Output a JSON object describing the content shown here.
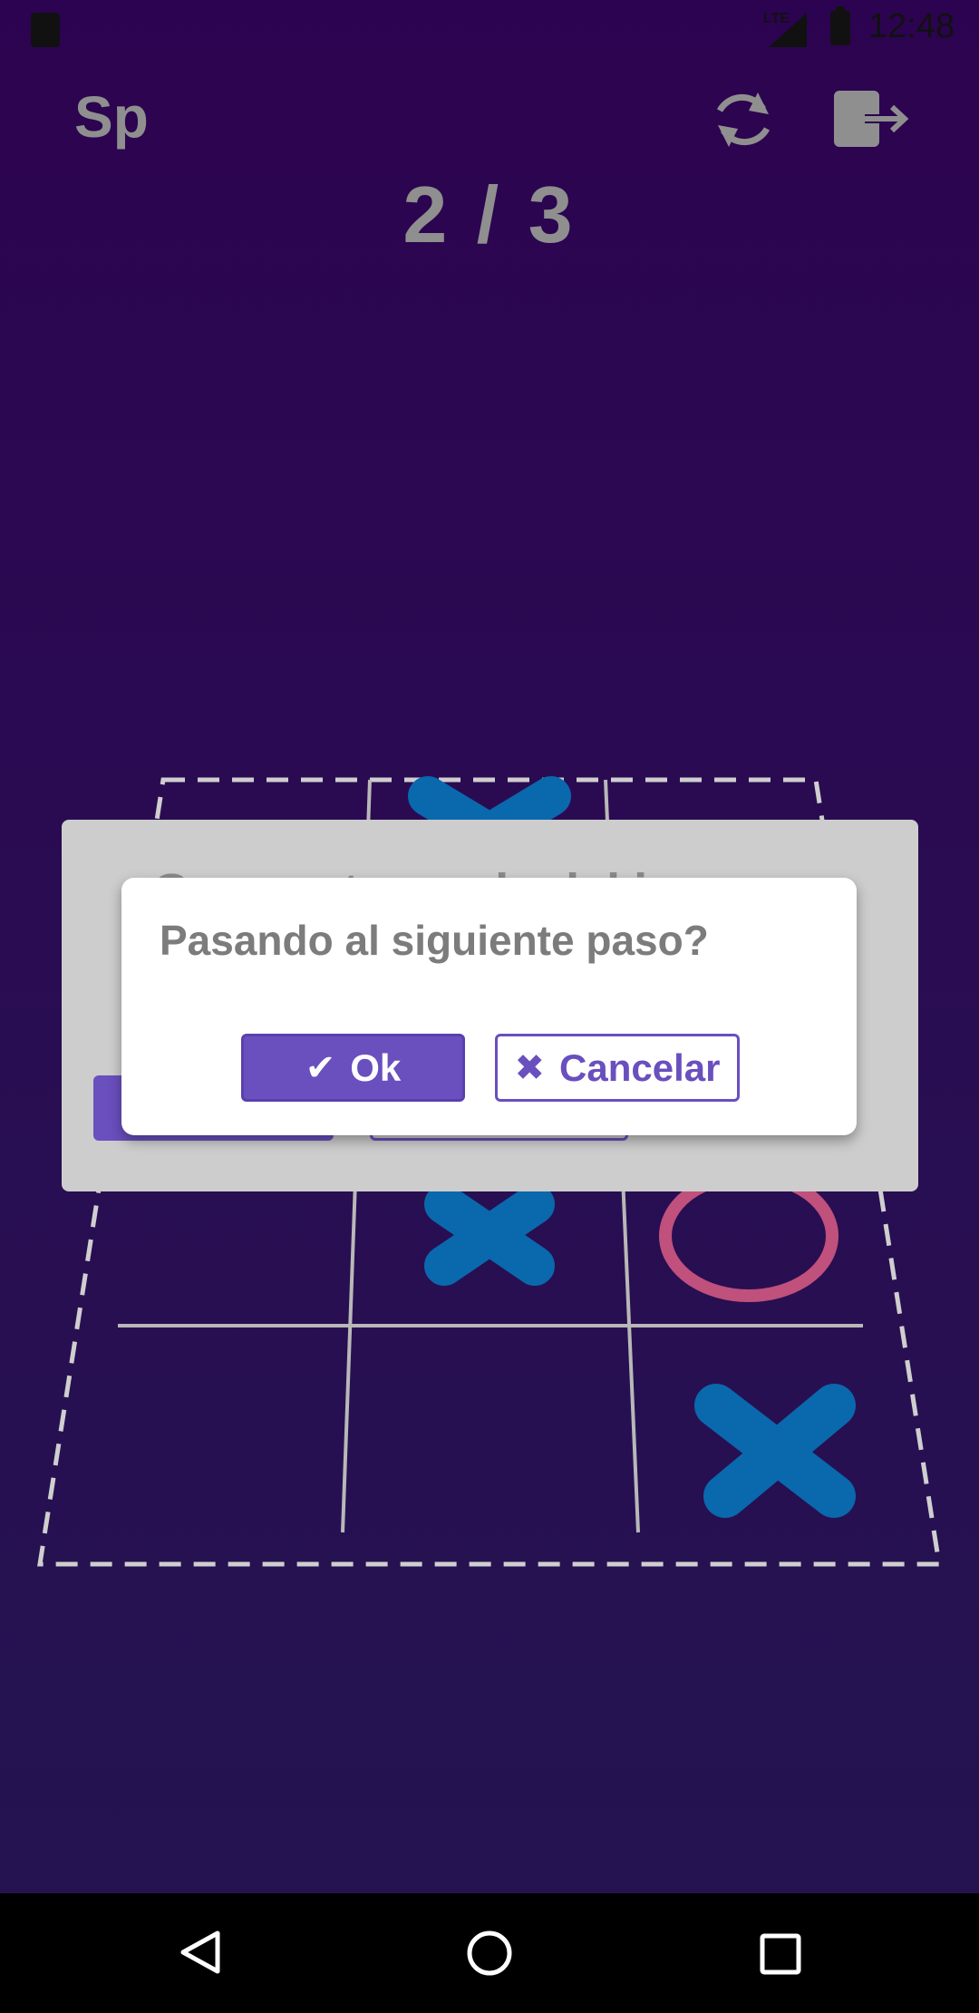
{
  "status_bar": {
    "network": "LTE",
    "time": "12:48",
    "icons": [
      "sd-card-icon",
      "signal-icon",
      "battery-charging-icon"
    ]
  },
  "header": {
    "title": "Sp",
    "refresh_icon": "refresh-icon",
    "exit_icon": "exit-icon"
  },
  "score": "2 / 3",
  "board": {
    "cells": [
      "X",
      "X",
      "O",
      "",
      "",
      "X"
    ],
    "colors": {
      "x": "#0a68ad",
      "o": "#c0507c",
      "grid": "#b8b8b8",
      "border": "#cfcfcf"
    }
  },
  "background_dialog": {
    "title": "Gana esta ronda del juego"
  },
  "confirm_dialog": {
    "message": "Pasando al siguiente paso?",
    "ok_label": "Ok",
    "ok_icon": "check-icon",
    "cancel_label": "Cancelar",
    "cancel_icon": "close-icon"
  },
  "colors": {
    "accent": "#6a4fbe",
    "background_top": "#2c0350",
    "background_bottom": "#231450"
  },
  "nav_bar": {
    "buttons": [
      "back-icon",
      "home-icon",
      "recents-icon"
    ]
  }
}
